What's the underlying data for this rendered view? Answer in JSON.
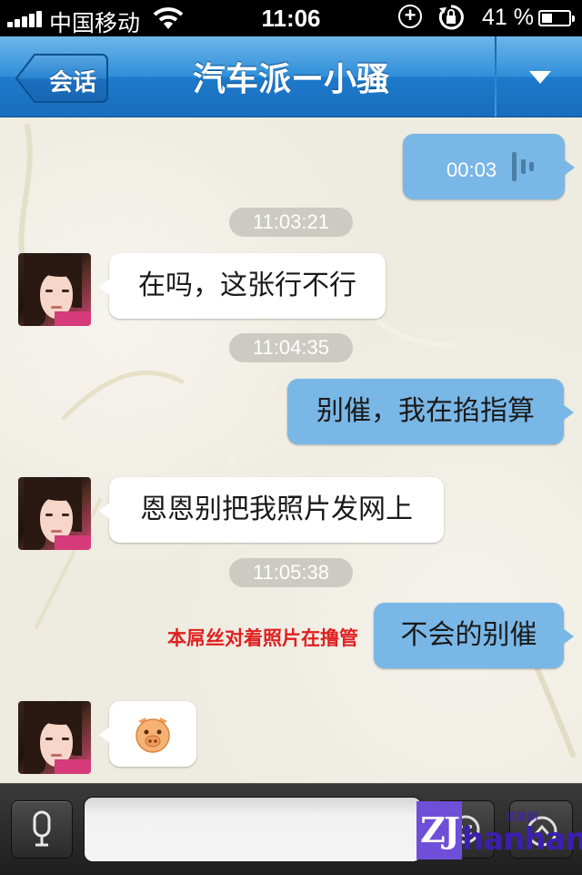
{
  "status_bar": {
    "carrier": "中国移动",
    "time": "11:06",
    "battery_percent": "41 %",
    "battery_level": 0.41
  },
  "nav": {
    "back_label": "会话",
    "title": "汽车派ー小骚",
    "menu_icon": "triangle-down-icon"
  },
  "messages": [
    {
      "side": "right",
      "type": "voice",
      "duration": "00:03"
    },
    {
      "type": "timestamp",
      "text": "11:03:21"
    },
    {
      "side": "left",
      "type": "text",
      "text": "在吗，这张行不行"
    },
    {
      "type": "timestamp",
      "text": "11:04:35"
    },
    {
      "side": "right",
      "type": "text",
      "text": "别催，我在掐指算"
    },
    {
      "side": "left",
      "type": "text",
      "text": "恩恩别把我照片发网上"
    },
    {
      "type": "timestamp",
      "text": "11:05:38"
    },
    {
      "side": "right",
      "type": "text",
      "text": "不会的别催",
      "note": "本屌丝对着照片在撸管"
    },
    {
      "side": "left",
      "type": "emoji",
      "emoji": "pig-face"
    }
  ],
  "input_bar": {
    "mic_icon": "microphone-icon",
    "input_value": "",
    "emoji_icon": "emoji-icon",
    "more_icon": "more-icon"
  },
  "watermark": {
    "logo": "ZJ",
    "text": "hanhang",
    "small_text": "追航网"
  },
  "colors": {
    "nav_blue": "#2f8fd9",
    "bubble_blue": "#79b7e6",
    "note_red": "#e02020",
    "timestamp_gray": "#cccac2"
  }
}
